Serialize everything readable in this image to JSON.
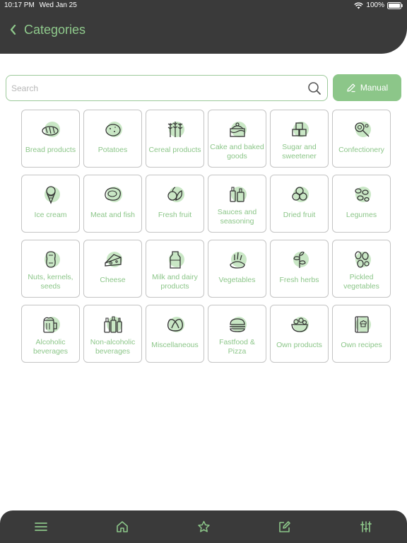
{
  "status": {
    "time": "10:17 PM",
    "date": "Wed Jan 25",
    "battery": "100%"
  },
  "header": {
    "title": "Categories",
    "back_icon": "chevron-left-icon"
  },
  "search": {
    "placeholder": "Search",
    "value": "",
    "icon": "search-icon"
  },
  "manual_button": {
    "label": "Manual",
    "icon": "pencil-icon"
  },
  "categories": [
    {
      "label": "Bread products",
      "icon": "bread-icon"
    },
    {
      "label": "Potatoes",
      "icon": "potato-icon"
    },
    {
      "label": "Cereal products",
      "icon": "wheat-icon"
    },
    {
      "label": "Cake and baked goods",
      "icon": "cake-icon"
    },
    {
      "label": "Sugar and sweetener",
      "icon": "sugar-cubes-icon"
    },
    {
      "label": "Confectionery",
      "icon": "candy-icon"
    },
    {
      "label": "Ice cream",
      "icon": "ice-cream-icon"
    },
    {
      "label": "Meat and fish",
      "icon": "steak-icon"
    },
    {
      "label": "Fresh fruit",
      "icon": "fruit-icon"
    },
    {
      "label": "Sauces and seasoning",
      "icon": "sauce-bottles-icon"
    },
    {
      "label": "Dried fruit",
      "icon": "dried-fruit-icon"
    },
    {
      "label": "Legumes",
      "icon": "beans-icon"
    },
    {
      "label": "Nuts, kernels, seeds",
      "icon": "peanut-icon"
    },
    {
      "label": "Cheese",
      "icon": "cheese-icon"
    },
    {
      "label": "Milk and dairy products",
      "icon": "milk-bottle-icon"
    },
    {
      "label": "Vegetables",
      "icon": "vegetables-icon"
    },
    {
      "label": "Fresh herbs",
      "icon": "herb-icon"
    },
    {
      "label": "Pickled vegetables",
      "icon": "pickles-icon"
    },
    {
      "label": "Alcoholic beverages",
      "icon": "beer-mug-icon"
    },
    {
      "label": "Non-alcoholic beverages",
      "icon": "bottles-icon"
    },
    {
      "label": "Miscellaneous",
      "icon": "pretzel-icon"
    },
    {
      "label": "Fastfood & Pizza",
      "icon": "burger-icon"
    },
    {
      "label": "Own products",
      "icon": "bowl-icon"
    },
    {
      "label": "Own recipes",
      "icon": "recipe-book-icon"
    }
  ],
  "bottom_nav": [
    {
      "icon": "menu-icon"
    },
    {
      "icon": "home-icon"
    },
    {
      "icon": "star-icon"
    },
    {
      "icon": "edit-icon"
    },
    {
      "icon": "sliders-icon"
    }
  ],
  "colors": {
    "accent": "#8cc689",
    "dark_bar": "#3a3a3a",
    "tile_border": "#c4c4c4"
  }
}
